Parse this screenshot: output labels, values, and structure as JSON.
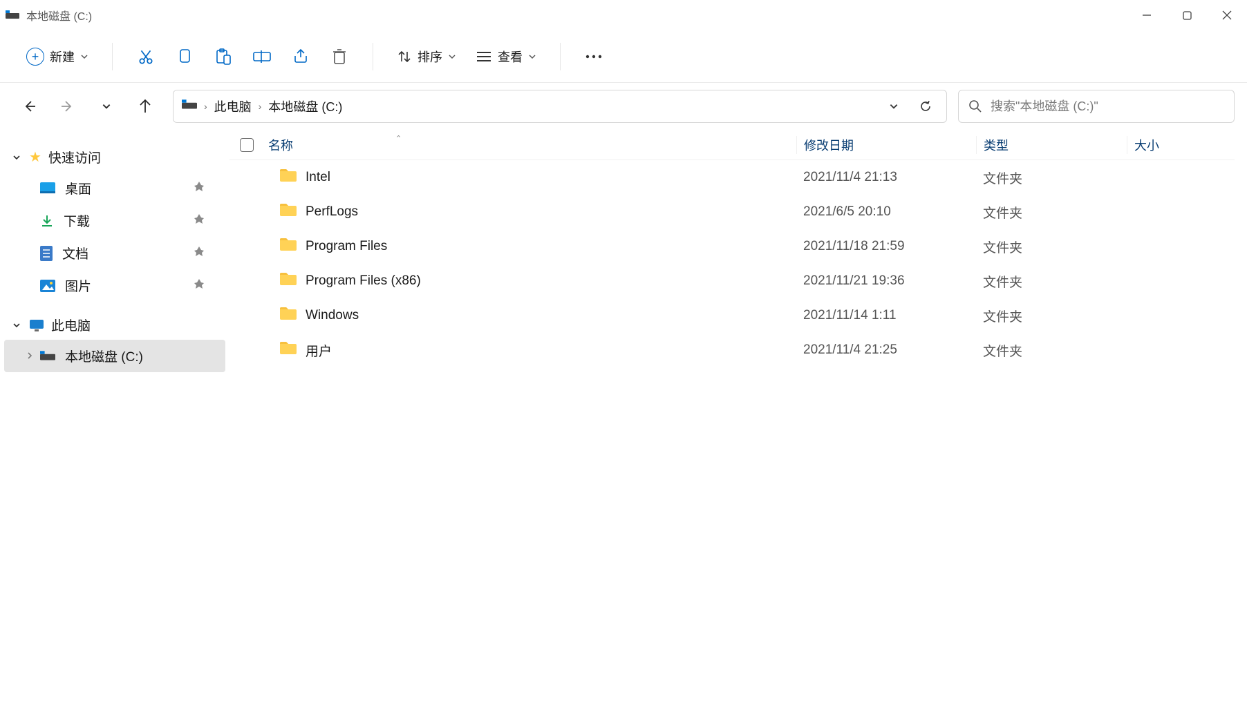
{
  "window": {
    "title": "本地磁盘 (C:)"
  },
  "toolbar": {
    "new_label": "新建",
    "sort_label": "排序",
    "view_label": "查看",
    "icons": {
      "new": "plus-circle-icon",
      "cut": "cut-icon",
      "copy": "copy-icon",
      "paste": "paste-icon",
      "rename": "rename-icon",
      "share": "share-icon",
      "delete": "delete-icon",
      "sort": "sort-icon",
      "view": "view-icon",
      "more": "more-icon"
    }
  },
  "breadcrumb": {
    "items": [
      "此电脑",
      "本地磁盘 (C:)"
    ]
  },
  "search": {
    "placeholder": "搜索\"本地磁盘 (C:)\""
  },
  "sidebar": {
    "quick_access": {
      "label": "快速访问",
      "items": [
        {
          "label": "桌面",
          "icon": "desktop-icon",
          "pinned": true
        },
        {
          "label": "下载",
          "icon": "downloads-icon",
          "pinned": true
        },
        {
          "label": "文档",
          "icon": "documents-icon",
          "pinned": true
        },
        {
          "label": "图片",
          "icon": "pictures-icon",
          "pinned": true
        }
      ]
    },
    "this_pc": {
      "label": "此电脑",
      "children": [
        {
          "label": "本地磁盘 (C:)",
          "selected": true
        }
      ]
    }
  },
  "columns": {
    "name": "名称",
    "date": "修改日期",
    "type": "类型",
    "size": "大小"
  },
  "files": [
    {
      "name": "Intel",
      "date": "2021/11/4 21:13",
      "type": "文件夹",
      "size": ""
    },
    {
      "name": "PerfLogs",
      "date": "2021/6/5 20:10",
      "type": "文件夹",
      "size": ""
    },
    {
      "name": "Program Files",
      "date": "2021/11/18 21:59",
      "type": "文件夹",
      "size": ""
    },
    {
      "name": "Program Files (x86)",
      "date": "2021/11/21 19:36",
      "type": "文件夹",
      "size": ""
    },
    {
      "name": "Windows",
      "date": "2021/11/14 1:11",
      "type": "文件夹",
      "size": ""
    },
    {
      "name": "用户",
      "date": "2021/11/4 21:25",
      "type": "文件夹",
      "size": ""
    }
  ]
}
